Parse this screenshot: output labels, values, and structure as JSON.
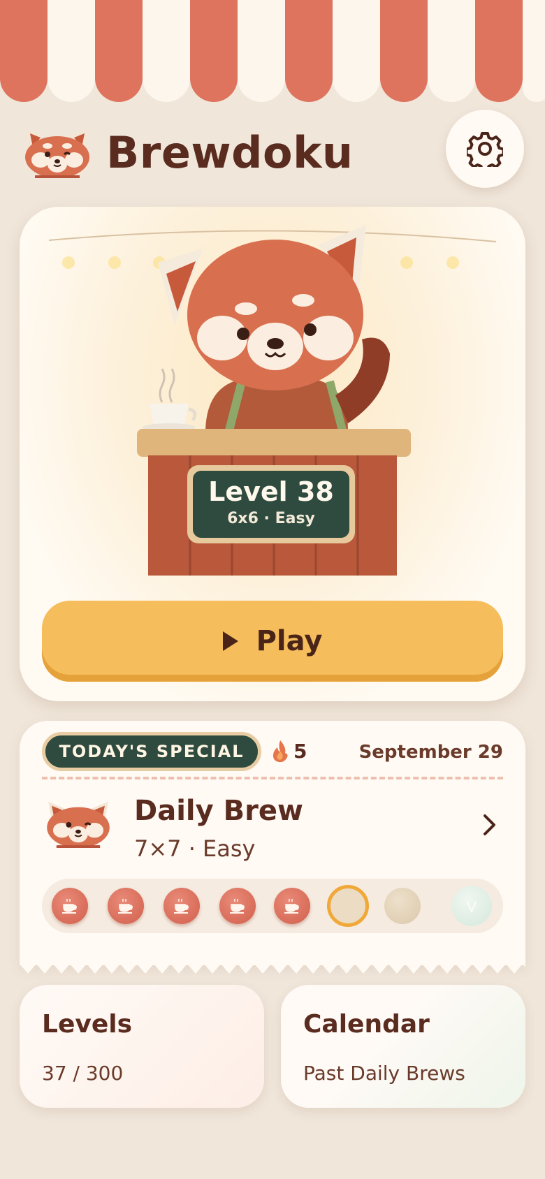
{
  "header": {
    "app_title": "Brewdoku",
    "settings_icon": "gear-icon"
  },
  "hero": {
    "level_title": "Level 38",
    "level_sub": "6x6 · Easy",
    "play_label": "Play",
    "play_icon": "play-icon"
  },
  "daily": {
    "badge": "TODAY'S SPECIAL",
    "streak_icon": "flame-icon",
    "streak_count": "5",
    "date": "September 29",
    "title": "Daily Brew",
    "subtitle": "7×7 · Easy",
    "progress": {
      "total": 8,
      "completed": 5,
      "current_index": 6
    }
  },
  "tiles": {
    "levels_title": "Levels",
    "levels_sub": "37 / 300",
    "calendar_title": "Calendar",
    "calendar_sub": "Past Daily Brews"
  },
  "colors": {
    "background": "#f0e6da",
    "awning_red": "#de735e",
    "awning_cream": "#fdf6ec",
    "play_button": "#f5bd5b",
    "chalkboard": "#2f4a3e",
    "text_brown": "#5a2b1f"
  }
}
